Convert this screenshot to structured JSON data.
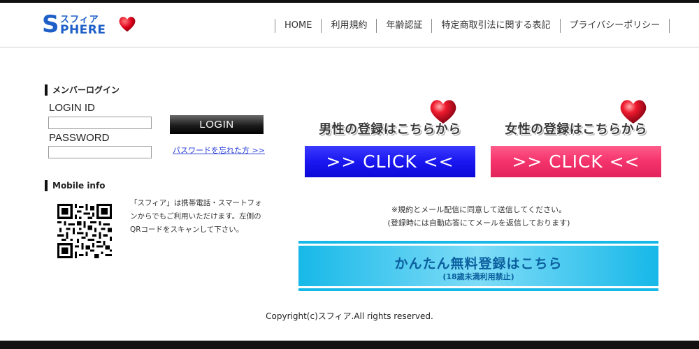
{
  "logo": {
    "kana": "スフィア",
    "text_s": "S",
    "text_rest": "PHERE"
  },
  "nav": [
    "HOME",
    "利用規約",
    "年齢認証",
    "特定商取引法に関する表記",
    "プライバシーポリシー"
  ],
  "login": {
    "heading": "メンバーログイン",
    "id_label": "LOGIN ID",
    "id_value": "",
    "password_label": "PASSWORD",
    "password_value": "",
    "button": "LOGIN",
    "forgot": "パスワードを忘れた方 >>"
  },
  "mobile": {
    "heading": "Mobile info",
    "text": "「スフィア」は携帯電話・スマートフォンからでもご利用いただけます。左側のQRコードをスキャンして下さい。"
  },
  "register": {
    "male_title": "男性の登録はこちらから",
    "female_title": "女性の登録はこちらから",
    "click_label": ">> CLICK <<",
    "colors": {
      "male": "#1a17f0",
      "female": "#f4326b"
    }
  },
  "notice": {
    "line1": "※規約とメール配信に同意して送信してください。",
    "line2": "(登録時には自動応答にてメールを返信しております)"
  },
  "free_register": {
    "main": "かんたん無料登録はこちら",
    "sub": "(18歳未満利用禁止)"
  },
  "copyright": "Copyright(c)スフィア.All rights reserved."
}
